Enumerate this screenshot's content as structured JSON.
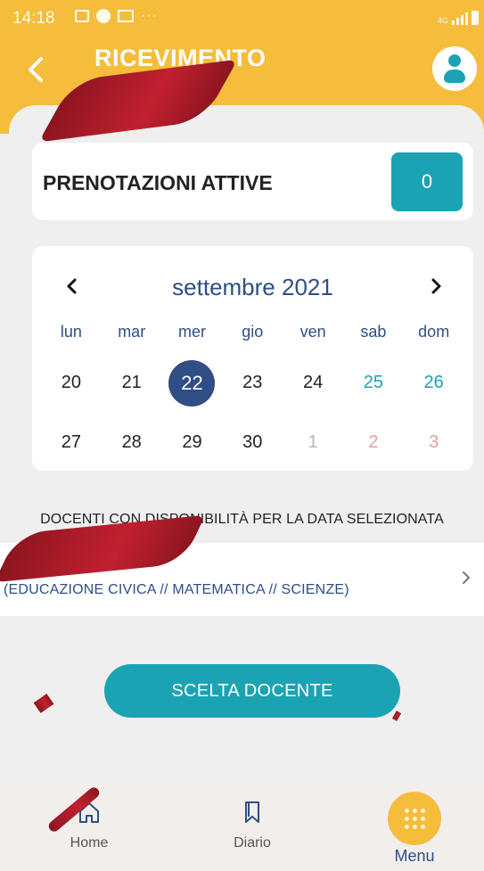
{
  "status_bar": {
    "time": "14:18",
    "network": "4G"
  },
  "header": {
    "back_label": "‹",
    "title": "RICEVIMENTO",
    "profile_icon": "user-icon"
  },
  "active_bookings": {
    "label": "PRENOTAZIONI ATTIVE",
    "count": "0"
  },
  "calendar": {
    "prev": "‹",
    "next": "›",
    "month_label": "settembre 2021",
    "weekdays": [
      "lun",
      "mar",
      "mer",
      "gio",
      "ven",
      "sab",
      "dom"
    ],
    "week1": [
      "20",
      "21",
      "22",
      "23",
      "24",
      "25",
      "26"
    ],
    "week2": [
      "27",
      "28",
      "29",
      "30",
      "1",
      "2",
      "3"
    ],
    "selected": "22",
    "colors": {
      "selected": "#2e4e85",
      "weekend": "#1ba3b4",
      "accent": "#f6bc3c"
    }
  },
  "availability": {
    "heading": "DOCENTI CON DISPONIBILITÀ PER LA DATA SELEZIONATA",
    "teacher_subjects": "(EDUCAZIONE CIVICA // MATEMATICA // SCIENZE)"
  },
  "choose_button": "SCELTA DOCENTE",
  "bottom_nav": {
    "home": "Home",
    "diario": "Diario",
    "menu": "Menu"
  }
}
